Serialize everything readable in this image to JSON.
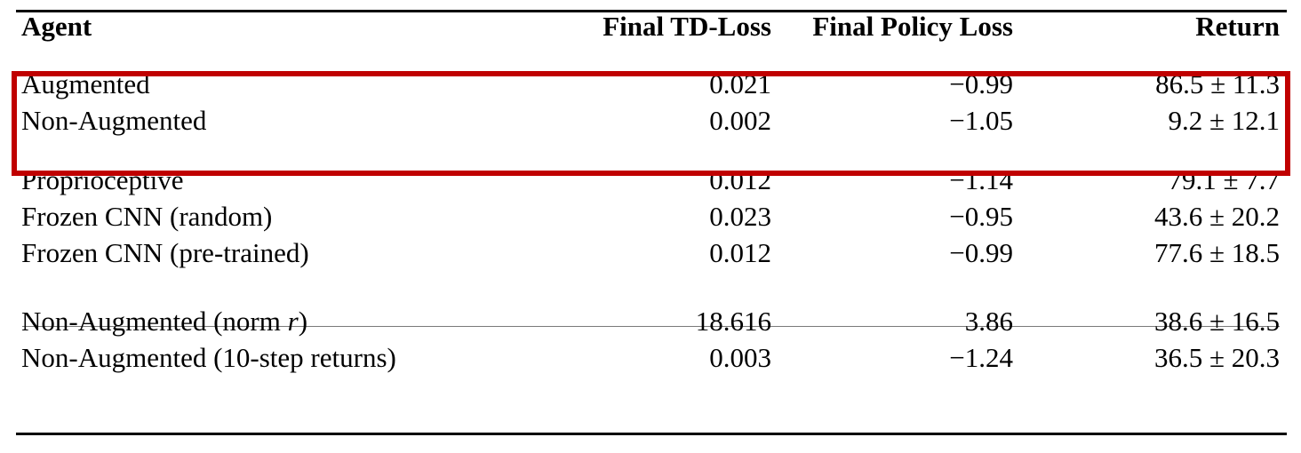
{
  "table": {
    "columns": [
      {
        "key": "agent",
        "label": "Agent",
        "align": "left"
      },
      {
        "key": "td",
        "label": "Final TD-Loss",
        "align": "right"
      },
      {
        "key": "policy",
        "label": "Final Policy Loss",
        "align": "right"
      },
      {
        "key": "return",
        "label": "Return",
        "align": "right"
      }
    ],
    "highlight": {
      "color": "#c00000",
      "rows": [
        "Augmented",
        "Non-Augmented"
      ]
    },
    "rules": {
      "top_color": "#000000",
      "bottom_color": "#000000",
      "mid_color": "#7a7a7a"
    },
    "blocks": [
      {
        "id": "highlighted-block",
        "rows": [
          {
            "agent": "Augmented",
            "td": "0.021",
            "policy": "−0.99",
            "return": "86.5 ± 11.3"
          },
          {
            "agent": "Non-Augmented",
            "td": "0.002",
            "policy": "−1.05",
            "return": "9.2 ± 12.1"
          }
        ]
      },
      {
        "id": "baselines-block",
        "rows": [
          {
            "agent": "Proprioceptive",
            "td": "0.012",
            "policy": "−1.14",
            "return": "79.1 ± 7.7"
          },
          {
            "agent": "Frozen CNN (random)",
            "td": "0.023",
            "policy": "−0.95",
            "return": "43.6 ± 20.2"
          },
          {
            "agent": "Frozen CNN (pre-trained)",
            "td": "0.012",
            "policy": "−0.99",
            "return": "77.6 ± 18.5"
          }
        ]
      },
      {
        "id": "ablations-block",
        "rows": [
          {
            "agent_prefix": "Non-Augmented (norm ",
            "agent_italic": "r",
            "agent_suffix": ")",
            "agent": "Non-Augmented (norm r)",
            "td": "18.616",
            "policy": "3.86",
            "return": "38.6 ± 16.5"
          },
          {
            "agent": "Non-Augmented (10-step returns)",
            "td": "0.003",
            "policy": "−1.24",
            "return": "36.5 ± 20.3"
          }
        ]
      }
    ]
  },
  "chart_data": {
    "type": "table",
    "title": "",
    "columns": [
      "Agent",
      "Final TD-Loss",
      "Final Policy Loss",
      "Return"
    ],
    "rows": [
      [
        "Augmented",
        0.021,
        -0.99,
        "86.5 ± 11.3"
      ],
      [
        "Non-Augmented",
        0.002,
        -1.05,
        "9.2 ± 12.1"
      ],
      [
        "Proprioceptive",
        0.012,
        -1.14,
        "79.1 ± 7.7"
      ],
      [
        "Frozen CNN (random)",
        0.023,
        -0.95,
        "43.6 ± 20.2"
      ],
      [
        "Frozen CNN (pre-trained)",
        0.012,
        -0.99,
        "77.6 ± 18.5"
      ],
      [
        "Non-Augmented (norm r)",
        18.616,
        3.86,
        "38.6 ± 16.5"
      ],
      [
        "Non-Augmented (10-step returns)",
        0.003,
        -1.24,
        "36.5 ± 20.3"
      ]
    ],
    "return_mean": [
      86.5,
      9.2,
      79.1,
      43.6,
      77.6,
      38.6,
      36.5
    ],
    "return_std": [
      11.3,
      12.1,
      7.7,
      20.2,
      18.5,
      16.5,
      20.3
    ]
  }
}
